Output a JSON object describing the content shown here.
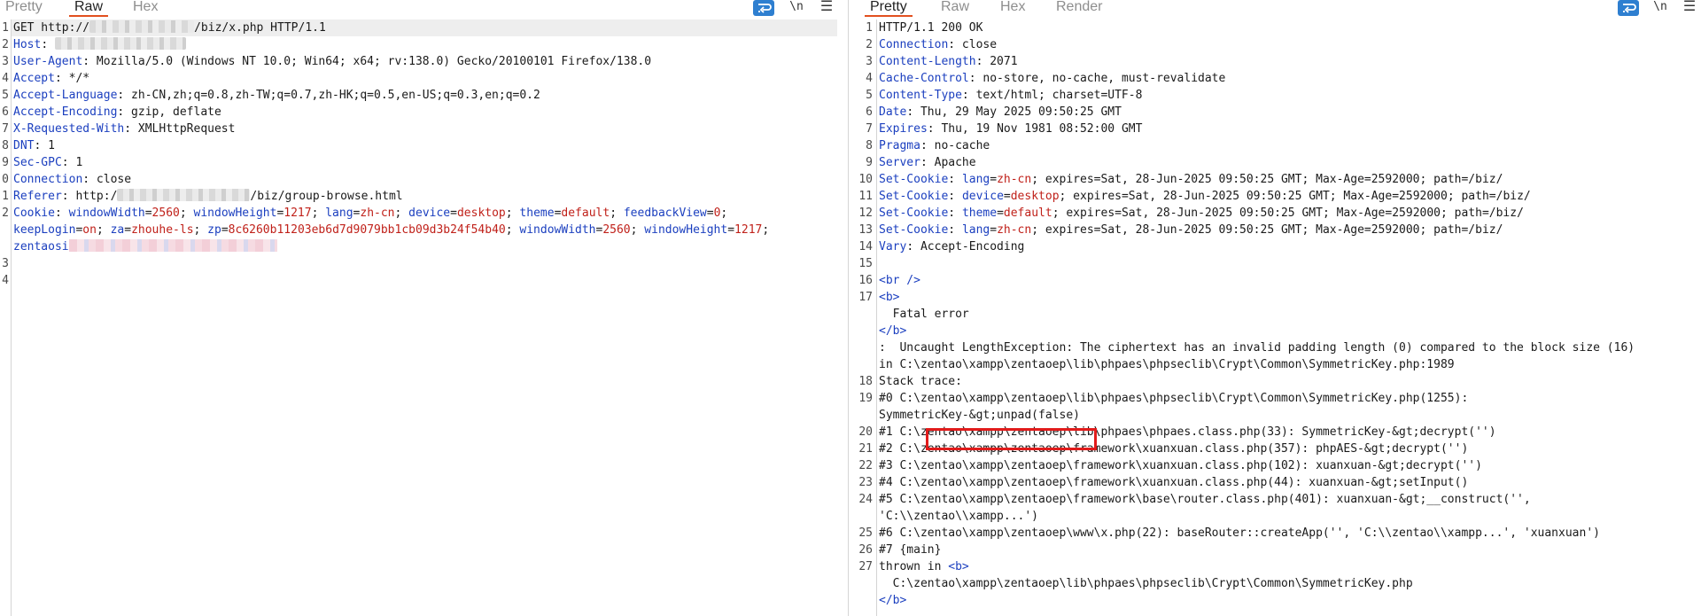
{
  "request": {
    "tabs": [
      {
        "label": "Pretty"
      },
      {
        "label": "Raw"
      },
      {
        "label": "Hex"
      }
    ],
    "active_tab": "Raw",
    "tools": {
      "wrap_icon": "word-wrap-icon",
      "newline_label": "\\n",
      "menu_icon": "hamburger-menu-icon"
    },
    "line_numbers": [
      "1",
      "2",
      "3",
      "4",
      "5",
      "6",
      "7",
      "8",
      "9",
      "0",
      "1",
      "2",
      "",
      "",
      "",
      "3",
      "4"
    ],
    "lines": {
      "l1_a": "GET http://",
      "l1_b": "/biz/x.php HTTP/1.1",
      "l2_name": "Host",
      "l3_name": "User-Agent",
      "l3_val": " Mozilla/5.0 (Windows NT 10.0; Win64; x64; rv:138.0) Gecko/20100101 Firefox/138.0",
      "l4_name": "Accept",
      "l4_val": " */*",
      "l5_name": "Accept-Language",
      "l5_val": " zh-CN,zh;q=0.8,zh-TW;q=0.7,zh-HK;q=0.5,en-US;q=0.3,en;q=0.2",
      "l6_name": "Accept-Encoding",
      "l6_val": " gzip, deflate",
      "l7_name": "X-Requested-With",
      "l7_val": " XMLHttpRequest",
      "l8_name": "DNT",
      "l8_val": " 1",
      "l9_name": "Sec-GPC",
      "l9_val": " 1",
      "l10_name": "Connection",
      "l10_val": " close",
      "l11_name": "Referer",
      "l11_a": " http:/",
      "l11_b": "/biz/group-browse.html",
      "l12_name": "Cookie",
      "cookies_1": [
        {
          "n": " windowWidth",
          "v": "2560"
        },
        {
          "n": " windowHeight",
          "v": "1217"
        },
        {
          "n": " lang",
          "v": "zh-cn"
        },
        {
          "n": " device",
          "v": "desktop"
        },
        {
          "n": " theme",
          "v": "default"
        },
        {
          "n": " feedbackView",
          "v": "0"
        }
      ],
      "cookies_2": [
        {
          "n": "keepLogin",
          "v": "on"
        },
        {
          "n": " za",
          "v": "zhouhe-ls"
        },
        {
          "n": " zp",
          "v": "8c6260b11203eb6d7d9079bb1cb09d3b24f54b40"
        },
        {
          "n": " windowWidth",
          "v": "2560"
        },
        {
          "n": " windowHeight",
          "v": "1217"
        }
      ],
      "cookies_3_name": "zentaosi"
    }
  },
  "response": {
    "tabs": [
      {
        "label": "Pretty"
      },
      {
        "label": "Raw"
      },
      {
        "label": "Hex"
      },
      {
        "label": "Render"
      }
    ],
    "active_tab": "Pretty",
    "tools": {
      "wrap_icon": "word-wrap-icon",
      "newline_label": "\\n",
      "menu_icon": "hamburger-menu-icon"
    },
    "line_numbers": [
      "1",
      "2",
      "3",
      "4",
      "5",
      "6",
      "7",
      "8",
      "9",
      "10",
      "11",
      "12",
      "13",
      "14",
      "15",
      "16",
      "17",
      "",
      "",
      "",
      "",
      "18",
      "19",
      "",
      "20",
      "21",
      "22",
      "23",
      "24",
      "",
      "25",
      "26",
      "27",
      "",
      ""
    ],
    "status": "HTTP/1.1 200 OK",
    "headers": [
      {
        "n": "Connection",
        "v": " close"
      },
      {
        "n": "Content-Length",
        "v": " 2071"
      },
      {
        "n": "Cache-Control",
        "v": " no-store, no-cache, must-revalidate"
      },
      {
        "n": "Content-Type",
        "v": " text/html; charset=UTF-8"
      },
      {
        "n": "Date",
        "v": " Thu, 29 May 2025 09:50:25 GMT"
      },
      {
        "n": "Expires",
        "v": " Thu, 19 Nov 1981 08:52:00 GMT"
      },
      {
        "n": "Pragma",
        "v": " no-cache"
      },
      {
        "n": "Server",
        "v": " Apache"
      }
    ],
    "set_cookies": [
      {
        "n": "Set-Cookie",
        "k": "lang",
        "v": "zh-cn",
        "rest": "; expires=Sat, 28-Jun-2025 09:50:25 GMT; Max-Age=2592000; path=/biz/"
      },
      {
        "n": "Set-Cookie",
        "k": "device",
        "v": "desktop",
        "rest": "; expires=Sat, 28-Jun-2025 09:50:25 GMT; Max-Age=2592000; path=/biz/"
      },
      {
        "n": "Set-Cookie",
        "k": "theme",
        "v": "default",
        "rest": "; expires=Sat, 28-Jun-2025 09:50:25 GMT; Max-Age=2592000; path=/biz/"
      },
      {
        "n": "Set-Cookie",
        "k": "lang",
        "v": "zh-cn",
        "rest": "; expires=Sat, 28-Jun-2025 09:50:25 GMT; Max-Age=2592000; path=/biz/"
      }
    ],
    "vary": {
      "n": "Vary",
      "v": " Accept-Encoding"
    },
    "body": [
      "<br />",
      "<b>",
      "  Fatal error",
      "</b>",
      ":  Uncaught LengthException: The ciphertext has an invalid padding length (0) compared to the block size (16)",
      "in C:\\zentao\\xampp\\zentaoep\\lib\\phpaes\\phpseclib\\Crypt\\Common\\SymmetricKey.php:1989",
      "Stack trace:",
      "#0 C:\\zentao\\xampp\\zentaoep\\lib\\phpaes\\phpseclib\\Crypt\\Common\\SymmetricKey.php(1255):",
      "SymmetricKey-&gt;unpad(false)",
      "#1 C:\\zentao\\xampp\\zentaoep\\lib\\phpaes\\phpaes.class.php(33): SymmetricKey-&gt;decrypt('')",
      "#2 C:\\zentao\\xampp\\zentaoep\\framework\\xuanxuan.class.php(357): phpAES-&gt;decrypt('')",
      "#3 C:\\zentao\\xampp\\zentaoep\\framework\\xuanxuan.class.php(102): xuanxuan-&gt;decrypt('')",
      "#4 C:\\zentao\\xampp\\zentaoep\\framework\\xuanxuan.class.php(44): xuanxuan-&gt;setInput()",
      "#5 C:\\zentao\\xampp\\zentaoep\\framework\\base\\router.class.php(401): xuanxuan-&gt;__construct('',",
      "'C:\\\\zentao\\\\xampp...')",
      "#6 C:\\zentao\\xampp\\zentaoep\\www\\x.php(22): baseRouter::createApp('', 'C:\\\\zentao\\\\xampp...', 'xuanxuan')",
      "#7 {main}",
      "thrown in ",
      "<b>",
      "  C:\\zentao\\xampp\\zentaoep\\lib\\phpaes\\phpseclib\\Crypt\\Common\\SymmetricKey.php",
      "</b>"
    ]
  }
}
